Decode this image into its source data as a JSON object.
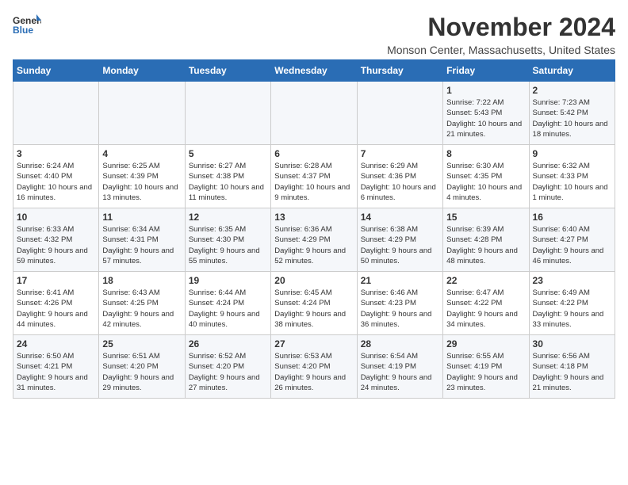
{
  "header": {
    "logo_line1": "General",
    "logo_line2": "Blue",
    "month": "November 2024",
    "location": "Monson Center, Massachusetts, United States"
  },
  "days_of_week": [
    "Sunday",
    "Monday",
    "Tuesday",
    "Wednesday",
    "Thursday",
    "Friday",
    "Saturday"
  ],
  "weeks": [
    [
      {
        "day": "",
        "info": ""
      },
      {
        "day": "",
        "info": ""
      },
      {
        "day": "",
        "info": ""
      },
      {
        "day": "",
        "info": ""
      },
      {
        "day": "",
        "info": ""
      },
      {
        "day": "1",
        "info": "Sunrise: 7:22 AM\nSunset: 5:43 PM\nDaylight: 10 hours and 21 minutes."
      },
      {
        "day": "2",
        "info": "Sunrise: 7:23 AM\nSunset: 5:42 PM\nDaylight: 10 hours and 18 minutes."
      }
    ],
    [
      {
        "day": "3",
        "info": "Sunrise: 6:24 AM\nSunset: 4:40 PM\nDaylight: 10 hours and 16 minutes."
      },
      {
        "day": "4",
        "info": "Sunrise: 6:25 AM\nSunset: 4:39 PM\nDaylight: 10 hours and 13 minutes."
      },
      {
        "day": "5",
        "info": "Sunrise: 6:27 AM\nSunset: 4:38 PM\nDaylight: 10 hours and 11 minutes."
      },
      {
        "day": "6",
        "info": "Sunrise: 6:28 AM\nSunset: 4:37 PM\nDaylight: 10 hours and 9 minutes."
      },
      {
        "day": "7",
        "info": "Sunrise: 6:29 AM\nSunset: 4:36 PM\nDaylight: 10 hours and 6 minutes."
      },
      {
        "day": "8",
        "info": "Sunrise: 6:30 AM\nSunset: 4:35 PM\nDaylight: 10 hours and 4 minutes."
      },
      {
        "day": "9",
        "info": "Sunrise: 6:32 AM\nSunset: 4:33 PM\nDaylight: 10 hours and 1 minute."
      }
    ],
    [
      {
        "day": "10",
        "info": "Sunrise: 6:33 AM\nSunset: 4:32 PM\nDaylight: 9 hours and 59 minutes."
      },
      {
        "day": "11",
        "info": "Sunrise: 6:34 AM\nSunset: 4:31 PM\nDaylight: 9 hours and 57 minutes."
      },
      {
        "day": "12",
        "info": "Sunrise: 6:35 AM\nSunset: 4:30 PM\nDaylight: 9 hours and 55 minutes."
      },
      {
        "day": "13",
        "info": "Sunrise: 6:36 AM\nSunset: 4:29 PM\nDaylight: 9 hours and 52 minutes."
      },
      {
        "day": "14",
        "info": "Sunrise: 6:38 AM\nSunset: 4:29 PM\nDaylight: 9 hours and 50 minutes."
      },
      {
        "day": "15",
        "info": "Sunrise: 6:39 AM\nSunset: 4:28 PM\nDaylight: 9 hours and 48 minutes."
      },
      {
        "day": "16",
        "info": "Sunrise: 6:40 AM\nSunset: 4:27 PM\nDaylight: 9 hours and 46 minutes."
      }
    ],
    [
      {
        "day": "17",
        "info": "Sunrise: 6:41 AM\nSunset: 4:26 PM\nDaylight: 9 hours and 44 minutes."
      },
      {
        "day": "18",
        "info": "Sunrise: 6:43 AM\nSunset: 4:25 PM\nDaylight: 9 hours and 42 minutes."
      },
      {
        "day": "19",
        "info": "Sunrise: 6:44 AM\nSunset: 4:24 PM\nDaylight: 9 hours and 40 minutes."
      },
      {
        "day": "20",
        "info": "Sunrise: 6:45 AM\nSunset: 4:24 PM\nDaylight: 9 hours and 38 minutes."
      },
      {
        "day": "21",
        "info": "Sunrise: 6:46 AM\nSunset: 4:23 PM\nDaylight: 9 hours and 36 minutes."
      },
      {
        "day": "22",
        "info": "Sunrise: 6:47 AM\nSunset: 4:22 PM\nDaylight: 9 hours and 34 minutes."
      },
      {
        "day": "23",
        "info": "Sunrise: 6:49 AM\nSunset: 4:22 PM\nDaylight: 9 hours and 33 minutes."
      }
    ],
    [
      {
        "day": "24",
        "info": "Sunrise: 6:50 AM\nSunset: 4:21 PM\nDaylight: 9 hours and 31 minutes."
      },
      {
        "day": "25",
        "info": "Sunrise: 6:51 AM\nSunset: 4:20 PM\nDaylight: 9 hours and 29 minutes."
      },
      {
        "day": "26",
        "info": "Sunrise: 6:52 AM\nSunset: 4:20 PM\nDaylight: 9 hours and 27 minutes."
      },
      {
        "day": "27",
        "info": "Sunrise: 6:53 AM\nSunset: 4:20 PM\nDaylight: 9 hours and 26 minutes."
      },
      {
        "day": "28",
        "info": "Sunrise: 6:54 AM\nSunset: 4:19 PM\nDaylight: 9 hours and 24 minutes."
      },
      {
        "day": "29",
        "info": "Sunrise: 6:55 AM\nSunset: 4:19 PM\nDaylight: 9 hours and 23 minutes."
      },
      {
        "day": "30",
        "info": "Sunrise: 6:56 AM\nSunset: 4:18 PM\nDaylight: 9 hours and 21 minutes."
      }
    ]
  ]
}
